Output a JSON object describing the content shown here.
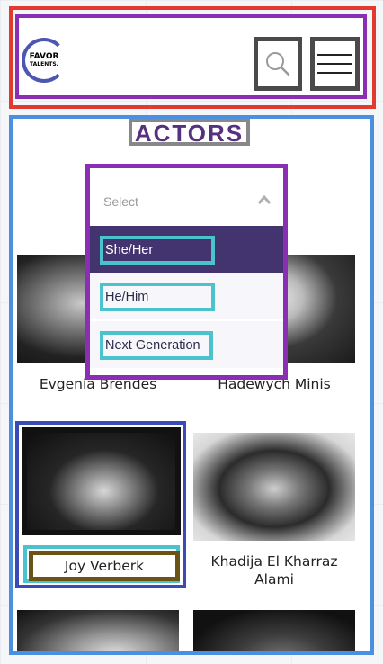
{
  "header": {
    "logo": {
      "line1": "FAVOR",
      "line2": "TALENTS."
    },
    "search_icon": "search-icon",
    "menu_icon": "hamburger-menu-icon"
  },
  "main": {
    "title": "ACTORS",
    "filter": {
      "placeholder": "Select",
      "chevron_icon": "chevron-up-icon",
      "options": [
        {
          "label": "She/Her",
          "selected": true
        },
        {
          "label": "He/Him",
          "selected": false
        },
        {
          "label": "Next Generation",
          "selected": false
        }
      ]
    },
    "actors": [
      {
        "name": "Evgenia Brendes"
      },
      {
        "name": "Hadewych Minis"
      },
      {
        "name": "Joy Verberk"
      },
      {
        "name_line1": "Khadija El Kharraz",
        "name_line2": "Alami"
      },
      {
        "name": ""
      },
      {
        "name": ""
      }
    ]
  },
  "colors": {
    "brand_purple": "#55317f",
    "selected_option_bg": "#43336f",
    "logo_ring": "#4e56b4"
  }
}
